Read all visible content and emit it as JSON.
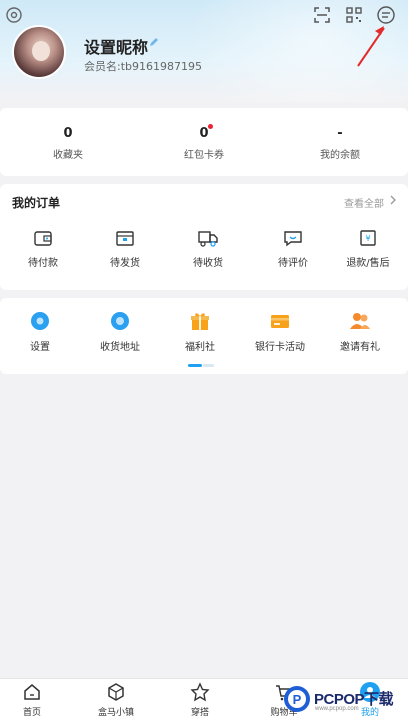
{
  "profile": {
    "nickname": "设置昵称",
    "member_label": "会员名:tb9161987195"
  },
  "stats": [
    {
      "value": "0",
      "label": "收藏夹",
      "badge": false
    },
    {
      "value": "0",
      "label": "红包卡券",
      "badge": true
    },
    {
      "value": "-",
      "label": "我的余额",
      "badge": false
    }
  ],
  "orders": {
    "title": "我的订单",
    "view_all": "查看全部",
    "items": [
      {
        "label": "待付款",
        "icon": "wallet-icon"
      },
      {
        "label": "待发货",
        "icon": "package-icon"
      },
      {
        "label": "待收货",
        "icon": "truck-icon"
      },
      {
        "label": "待评价",
        "icon": "comment-icon"
      },
      {
        "label": "退款/售后",
        "icon": "refund-icon"
      }
    ]
  },
  "tools": {
    "items": [
      {
        "label": "设置",
        "icon": "settings-gear-icon",
        "color": "#2b9ff0"
      },
      {
        "label": "收货地址",
        "icon": "location-icon",
        "color": "#2b9ff0"
      },
      {
        "label": "福利社",
        "icon": "gift-icon",
        "color": "#f7a21a"
      },
      {
        "label": "银行卡活动",
        "icon": "bank-card-icon",
        "color": "#f7a21a"
      },
      {
        "label": "邀请有礼",
        "icon": "invite-icon",
        "color": "#f58a2a"
      }
    ],
    "page_indicator": {
      "current": 1,
      "total": 2
    }
  },
  "bottom_nav": {
    "items": [
      {
        "label": "首页",
        "icon": "home-icon",
        "active": false
      },
      {
        "label": "盒马小镇",
        "icon": "cube-icon",
        "active": false
      },
      {
        "label": "穿搭",
        "icon": "star-icon",
        "active": false
      },
      {
        "label": "购物车",
        "icon": "cart-icon",
        "active": false
      },
      {
        "label": "我的",
        "icon": "profile-icon",
        "active": true
      }
    ]
  },
  "watermark": {
    "brand": "PCPOP下载",
    "sub": "www.pcpop.com"
  },
  "colors": {
    "accent": "#1fa0f0",
    "badge": "#e23333",
    "orange": "#f7a21a"
  }
}
